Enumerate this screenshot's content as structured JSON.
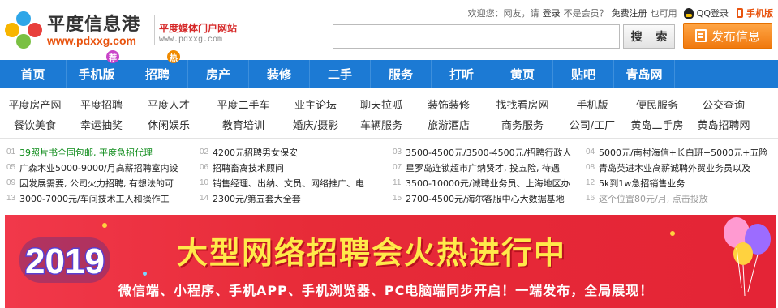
{
  "header": {
    "welcome": "欢迎您：网友，请",
    "login": "登录",
    "not_member": "不是会员？",
    "register": "免费注册",
    "also_can": "也可用",
    "qq_login": "QQ登录",
    "mobile": "手机版"
  },
  "logo": {
    "title": "平度信息港",
    "url": "www.pdxxg.com",
    "slogan": "平度媒体门户网站",
    "slogan_url": "www.pdxxg.com"
  },
  "search": {
    "value": "",
    "button": "搜 索",
    "publish": "发布信息"
  },
  "nav": [
    {
      "label": "首页",
      "badge": ""
    },
    {
      "label": "手机版",
      "badge": "荐",
      "badge_color": "#c944c8"
    },
    {
      "label": "招聘",
      "badge": "热",
      "badge_color": "#f08a00"
    },
    {
      "label": "房产",
      "badge": ""
    },
    {
      "label": "装修",
      "badge": ""
    },
    {
      "label": "二手",
      "badge": ""
    },
    {
      "label": "服务",
      "badge": ""
    },
    {
      "label": "打听",
      "badge": ""
    },
    {
      "label": "黄页",
      "badge": ""
    },
    {
      "label": "贴吧",
      "badge": ""
    },
    {
      "label": "青岛网",
      "badge": ""
    }
  ],
  "sublinks": {
    "row1": [
      "平度房产网",
      "平度招聘",
      "平度人才",
      "平度二手车",
      "业主论坛",
      "聊天拉呱",
      "装饰装修",
      "找找看房网",
      "手机版",
      "便民服务",
      "公交查询"
    ],
    "row2": [
      "餐饮美食",
      "幸运抽奖",
      "休闲娱乐",
      "教育培训",
      "婚庆/摄影",
      "车辆服务",
      "旅游酒店",
      "商务服务",
      "公司/工厂",
      "黄岛二手房",
      "黄岛招聘网"
    ]
  },
  "ads": [
    {
      "num": "01",
      "text": "39照片书全国包邮, 平度急招代理",
      "style": "green"
    },
    {
      "num": "02",
      "text": "4200元招聘男女保安",
      "style": ""
    },
    {
      "num": "03",
      "text": "3500-4500元/3500-4500元/招聘行政人",
      "style": ""
    },
    {
      "num": "04",
      "text": "5000元/南村海信+长白班+5000元+五险",
      "style": ""
    },
    {
      "num": "05",
      "text": "广森木业5000-9000/月高薪招聘室内设",
      "style": ""
    },
    {
      "num": "06",
      "text": "招聘畜禽技术顾问",
      "style": ""
    },
    {
      "num": "07",
      "text": "星罗岛连锁超市广纳贤才, 投五险, 待遇",
      "style": ""
    },
    {
      "num": "08",
      "text": "青岛英进木业高薪诚聘外贸业务员以及",
      "style": ""
    },
    {
      "num": "09",
      "text": "因发展需要, 公司火力招聘, 有想法的可",
      "style": ""
    },
    {
      "num": "10",
      "text": "销售经理、出纳、文员、网络推广、电",
      "style": ""
    },
    {
      "num": "11",
      "text": "3500-10000元/诚聘业务员、上海地区办",
      "style": ""
    },
    {
      "num": "12",
      "text": "5k到1w急招销售业务",
      "style": ""
    },
    {
      "num": "13",
      "text": "3000-7000元/车间技术工人和操作工",
      "style": ""
    },
    {
      "num": "14",
      "text": "2300元/第五套大全套",
      "style": ""
    },
    {
      "num": "15",
      "text": "2700-4500元/海尔客服中心大数据基地",
      "style": ""
    },
    {
      "num": "16",
      "text": "这个位置80元/月, 点击投放",
      "style": "gray"
    }
  ],
  "banner": {
    "year": "2019",
    "title": "大型网络招聘会火热进行中",
    "subtitle": "微信端、小程序、手机APP、手机浏览器、PC电脑端同步开启！一端发布，全局展现！"
  }
}
